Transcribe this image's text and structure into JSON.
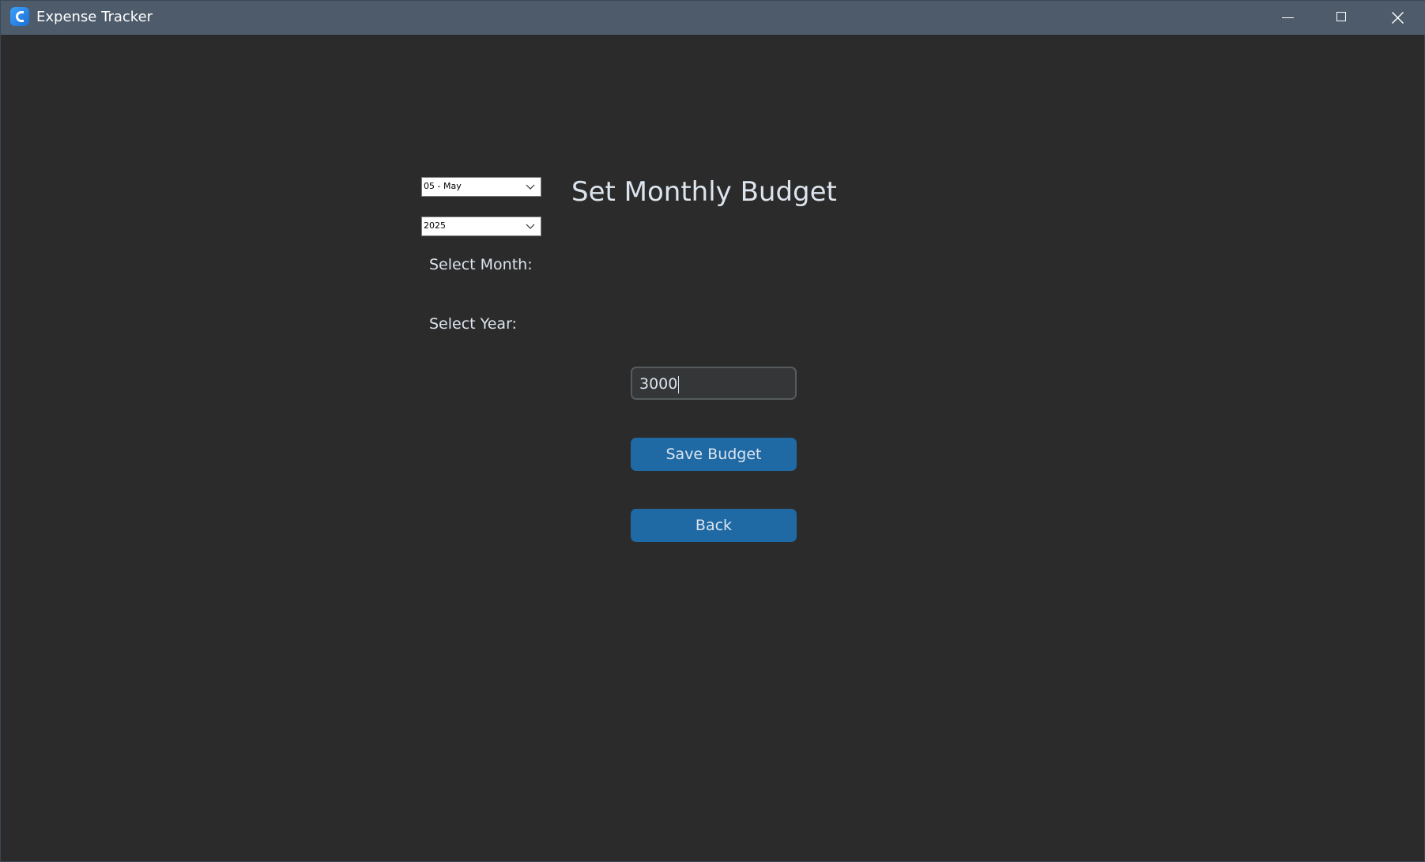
{
  "window": {
    "title": "Expense Tracker",
    "controls": {
      "minimize_icon": "minimize-icon",
      "maximize_icon": "maximize-icon",
      "close_icon": "close-icon"
    }
  },
  "form": {
    "heading": "Set Monthly Budget",
    "month_select": {
      "label": "Select Month:",
      "selected": "05 - May"
    },
    "year_select": {
      "label": "Select Year:",
      "selected": "2025"
    },
    "budget_input": {
      "value": "3000"
    },
    "save_button": "Save Budget",
    "back_button": "Back"
  },
  "colors": {
    "background": "#2b2b2b",
    "titlebar": "#4e5b6b",
    "button": "#1f6aa5",
    "text": "#dce4ee",
    "input_bg": "#343638",
    "input_border": "#565b5e"
  }
}
